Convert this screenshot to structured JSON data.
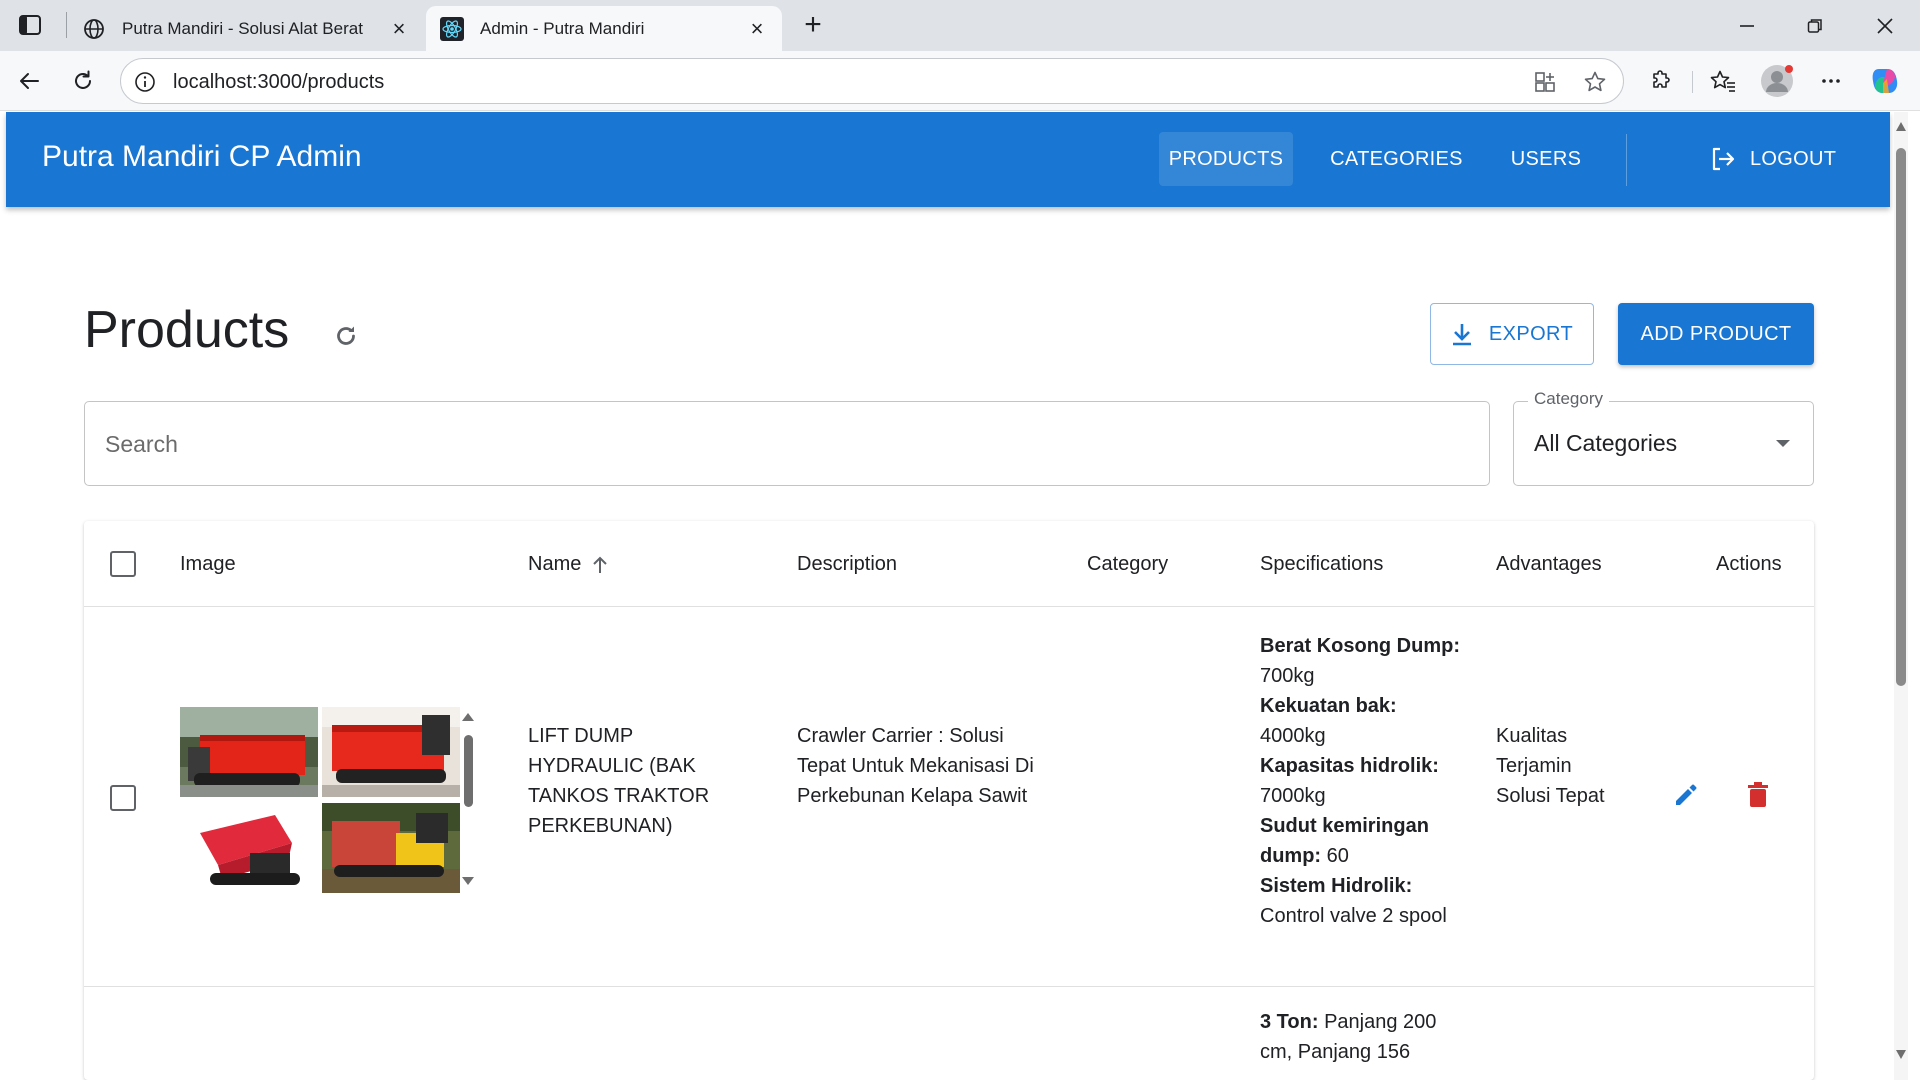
{
  "browser": {
    "tabs": [
      {
        "title": "Putra Mandiri - Solusi Alat Berat",
        "icon": "globe-icon",
        "active": false
      },
      {
        "title": "Admin - Putra Mandiri",
        "icon": "react-icon",
        "active": true
      }
    ],
    "url": "localhost:3000/products"
  },
  "appbar": {
    "title": "Putra Mandiri CP Admin",
    "nav": {
      "products": "PRODUCTS",
      "categories": "CATEGORIES",
      "users": "USERS"
    },
    "logout": "LOGOUT"
  },
  "page": {
    "title": "Products",
    "export_label": "EXPORT",
    "add_label": "ADD PRODUCT"
  },
  "filters": {
    "search_placeholder": "Search",
    "category_label": "Category",
    "category_value": "All Categories"
  },
  "table": {
    "headers": {
      "image": "Image",
      "name": "Name",
      "description": "Description",
      "category": "Category",
      "specifications": "Specifications",
      "advantages": "Advantages",
      "actions": "Actions"
    },
    "rows": [
      {
        "name": "LIFT DUMP HYDRAULIC (BAK TANKOS TRAKTOR PERKEBUNAN)",
        "description": "Crawler Carrier : Solusi Tepat Untuk Mekanisasi Di Perkebunan Kelapa Sawit",
        "category": "",
        "specifications": [
          {
            "label": "Berat Kosong Dump:",
            "value": "700kg"
          },
          {
            "label": "Kekuatan bak:",
            "value": "4000kg"
          },
          {
            "label": "Kapasitas hidrolik:",
            "value": "7000kg"
          },
          {
            "label": "Sudut kemiringan dump:",
            "value": "60"
          },
          {
            "label": "Sistem Hidrolik:",
            "value": "Control valve 2 spool"
          }
        ],
        "advantages": "Kualitas Terjamin Solusi Tepat"
      },
      {
        "specifications": [
          {
            "label": "3 Ton:",
            "value": "Panjang 200 cm, Panjang 156"
          }
        ]
      }
    ]
  },
  "colors": {
    "primary": "#1976d2",
    "danger": "#d32f2f"
  }
}
